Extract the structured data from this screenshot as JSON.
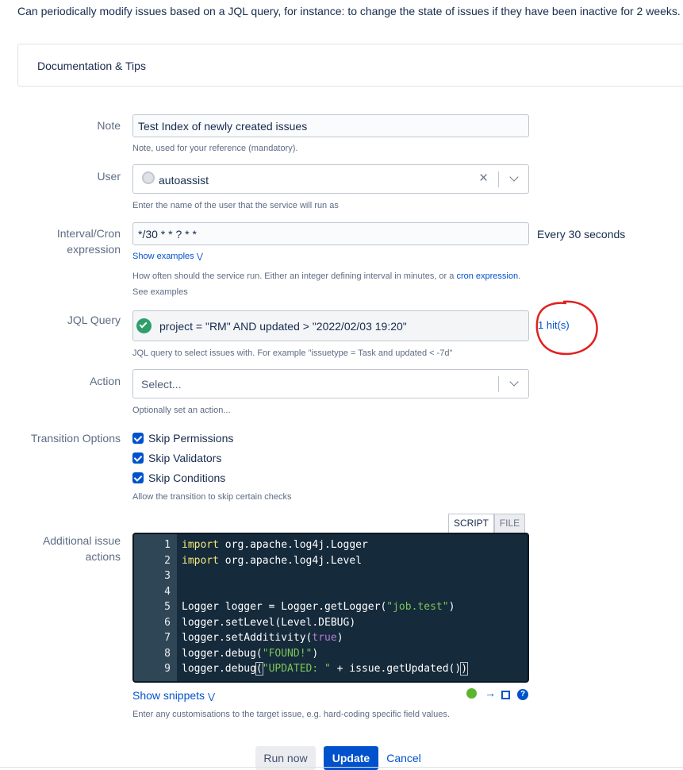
{
  "intro_text": "Can periodically modify issues based on a JQL query, for instance: to change the state of issues if they have been inactive for 2 weeks.",
  "doc_panel_title": "Documentation & Tips",
  "note": {
    "label": "Note",
    "value": "Test Index of newly created issues",
    "help": "Note, used for your reference (mandatory)."
  },
  "user": {
    "label": "User",
    "value": "autoassist",
    "help": "Enter the name of the user that the service will run as"
  },
  "interval": {
    "label_line1": "Interval/Cron",
    "label_line2": "expression",
    "value": "*/30 * * ? * *",
    "description": "Every 30 seconds",
    "show_examples": "Show examples",
    "help_prefix": "How often should the service run. Either an integer defining interval in minutes, or a ",
    "help_link": "cron expression",
    "help_suffix": ".",
    "help_line2": "See examples"
  },
  "jql": {
    "label": "JQL Query",
    "value": "project = \"RM\" AND updated > \"2022/02/03 19:20\"",
    "hits": "1 hit(s)",
    "help": "JQL query to select issues with. For example \"issuetype = Task and updated < -7d\""
  },
  "action": {
    "label": "Action",
    "placeholder": "Select...",
    "help": "Optionally set an action..."
  },
  "transition": {
    "label": "Transition Options",
    "options": [
      "Skip Permissions",
      "Skip Validators",
      "Skip Conditions"
    ],
    "help": "Allow the transition to skip certain checks"
  },
  "additional": {
    "label_line1": "Additional issue",
    "label_line2": "actions",
    "tab_script": "SCRIPT",
    "tab_file": "FILE",
    "line_numbers": [
      "1",
      "2",
      "3",
      "4",
      "5",
      "6",
      "7",
      "8",
      "9"
    ],
    "show_snippets": "Show snippets",
    "help": "Enter any customisations to the target issue, e.g. hard-coding specific field values."
  },
  "buttons": {
    "run_now": "Run now",
    "update": "Update",
    "cancel": "Cancel"
  },
  "colors": {
    "primary": "#0052cc",
    "success": "#36b37e",
    "annotation": "#e02020"
  }
}
